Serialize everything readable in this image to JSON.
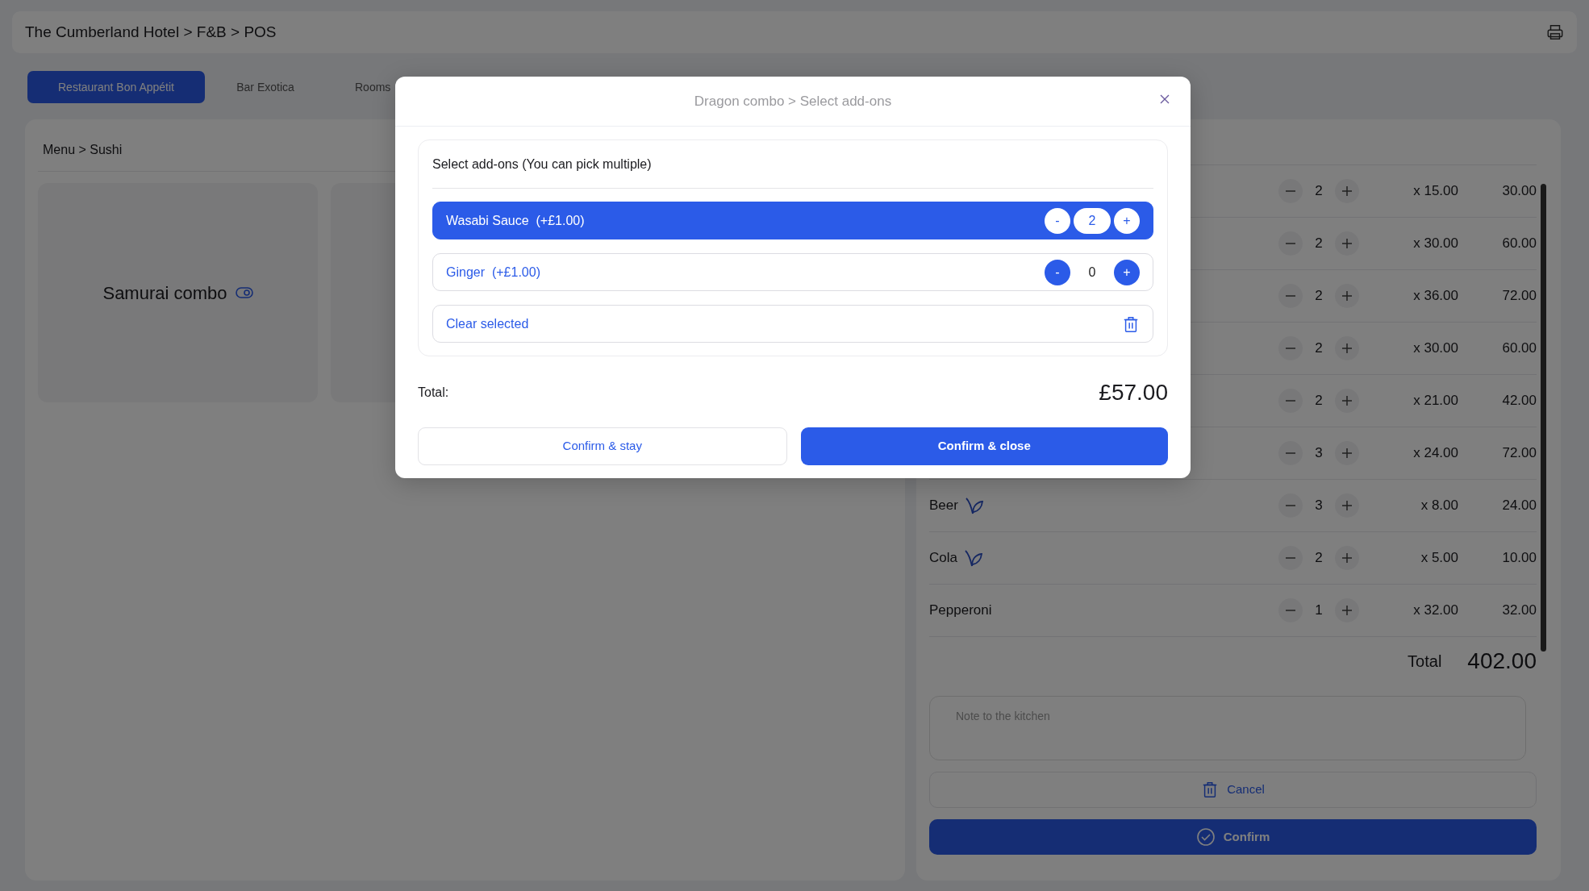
{
  "header": {
    "breadcrumb": "The Cumberland Hotel > F&B > POS"
  },
  "tabs": [
    {
      "label": "Restaurant Bon Appétit",
      "selected": true
    },
    {
      "label": "Bar Exotica",
      "selected": false
    },
    {
      "label": "Rooms",
      "selected": false
    }
  ],
  "menu": {
    "breadcrumb": "Menu > Sushi",
    "items": [
      {
        "kind": "combo",
        "name": "Samurai combo"
      },
      {
        "kind": "covered"
      }
    ]
  },
  "order": {
    "rows": [
      {
        "qty": "2",
        "price": "x 15.00",
        "total": "30.00"
      },
      {
        "qty": "2",
        "price": "x 30.00",
        "total": "60.00"
      },
      {
        "qty": "2",
        "price": "x 36.00",
        "total": "72.00"
      },
      {
        "qty": "2",
        "price": "x 30.00",
        "total": "60.00"
      },
      {
        "qty": "2",
        "price": "x 21.00",
        "total": "42.00"
      },
      {
        "qty": "3",
        "price": "x 24.00",
        "total": "72.00"
      },
      {
        "name": "Beer",
        "leaf": true,
        "qty": "3",
        "price": "x 8.00",
        "total": "24.00"
      },
      {
        "name": "Cola",
        "leaf": true,
        "qty": "2",
        "price": "x 5.00",
        "total": "10.00"
      },
      {
        "name": "Pepperoni",
        "leaf": false,
        "qty": "1",
        "price": "x 32.00",
        "total": "32.00"
      }
    ],
    "total_label": "Total",
    "total_value": "402.00",
    "note": {
      "placeholder": "Note to the kitchen"
    },
    "cancel": "Cancel",
    "confirm": "Confirm"
  },
  "modal": {
    "title": "Dragon combo > Select add-ons",
    "card_title": "Select add-ons (You can pick multiple)",
    "addons": [
      {
        "name": "Wasabi Sauce",
        "price": "(+£1.00)",
        "qty": "2",
        "minus": "-",
        "plus": "+",
        "selected": true
      },
      {
        "name": "Ginger",
        "price": "(+£1.00)",
        "qty": "0",
        "minus": "-",
        "plus": "+",
        "selected": false
      }
    ],
    "clear": "Clear selected",
    "total_label": "Total:",
    "total_value": "£57.00",
    "buttons": [
      {
        "label": "Confirm & stay",
        "kind": "outline"
      },
      {
        "label": "Confirm & close",
        "kind": "primary"
      }
    ]
  }
}
